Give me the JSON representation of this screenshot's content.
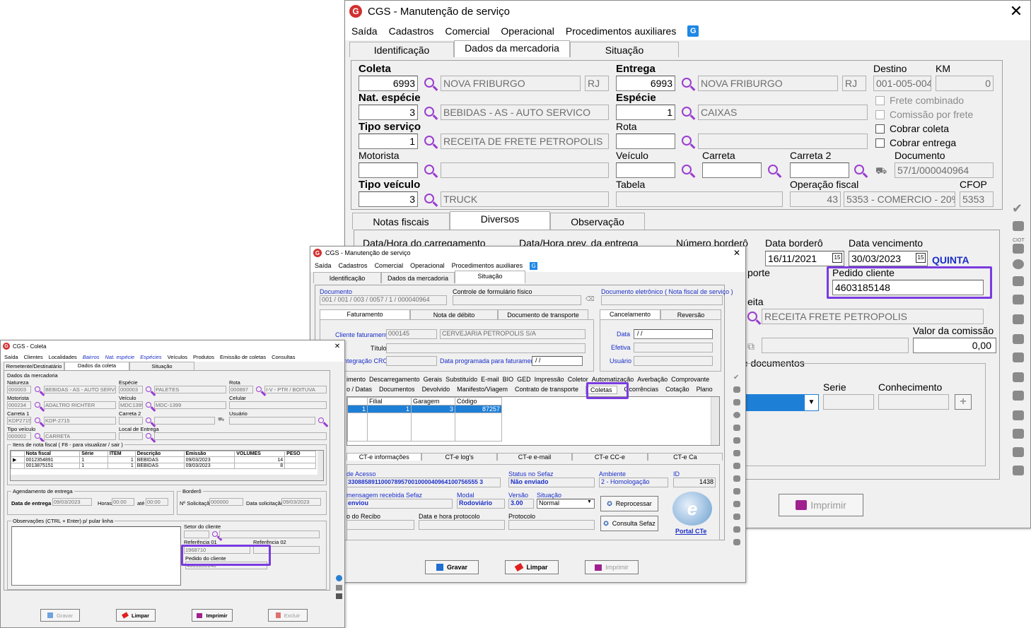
{
  "main": {
    "title": "CGS - Manutenção de serviço",
    "menu": [
      "Saída",
      "Cadastros",
      "Comercial",
      "Operacional",
      "Procedimentos auxiliares"
    ],
    "tabs": [
      "Identificação",
      "Dados da mercadoria",
      "Situação"
    ],
    "coleta_lbl": "Coleta",
    "coleta_code": "6993",
    "coleta_city": "NOVA FRIBURGO",
    "coleta_uf": "RJ",
    "entrega_lbl": "Entrega",
    "entrega_code": "6993",
    "entrega_city": "NOVA FRIBURGO",
    "entrega_uf": "RJ",
    "destino_lbl": "Destino",
    "destino": "001-005-004",
    "km_lbl": "KM",
    "km": "0",
    "natesp_lbl": "Nat. espécie",
    "natesp_code": "3",
    "natesp_desc": "BEBIDAS - AS - AUTO SERVICO",
    "especie_lbl": "Espécie",
    "especie_code": "1",
    "especie_desc": "CAIXAS",
    "frete_comb": "Frete combinado",
    "comissao": "Comissão por frete",
    "cobrar_coleta": "Cobrar coleta",
    "cobrar_entrega": "Cobrar entrega",
    "tiposerv_lbl": "Tipo serviço",
    "tiposerv_code": "1",
    "tiposerv_desc": "RECEITA DE FRETE PETROPOLIS",
    "rota_lbl": "Rota",
    "motorista_lbl": "Motorista",
    "veiculo_lbl": "Veículo",
    "carreta_lbl": "Carreta",
    "carreta2_lbl": "Carreta 2",
    "documento_lbl": "Documento",
    "documento": "57/1/000040964",
    "tipoveic_lbl": "Tipo veículo",
    "tipoveic_code": "3",
    "tipoveic_desc": "TRUCK",
    "tabela_lbl": "Tabela",
    "opfiscal_lbl": "Operação fiscal",
    "opfiscal_code": "43",
    "opfiscal_desc": "5353 - COMERCIO - 20%",
    "cfop_lbl": "CFOP",
    "cfop": "5353",
    "subtabs": [
      "Notas fiscais",
      "Diversos",
      "Observação"
    ],
    "dh_carreg": "Data/Hora do carregamento",
    "dh_prev": "Data/Hora prev. da entrega",
    "num_bordero": "Número borderô",
    "data_bordero_lbl": "Data borderô",
    "data_bordero": "16/11/2021",
    "data_venc_lbl": "Data vencimento",
    "data_venc": "30/03/2023",
    "dia": "QUINTA",
    "porte_frag": "porte",
    "pedido_lbl": "Pedido cliente",
    "pedido": "4603185148",
    "eita_frag": "eita",
    "receita": "RECEITA FRETE PETROPOLIS",
    "valor_com_lbl": "Valor da comissão",
    "valor_com": "0,00",
    "de_docs": "de documentos",
    "serie_lbl": "Serie",
    "conhec_lbl": "Conhecimento",
    "imprimir": "Imprimir",
    "side_label": "CIOT"
  },
  "mid": {
    "title": "CGS - Manutenção de serviço",
    "menu": [
      "Saída",
      "Cadastros",
      "Comercial",
      "Operacional",
      "Procedimentos auxiliares"
    ],
    "tabs": [
      "Identificação",
      "Dados da mercadoria",
      "Situação"
    ],
    "documento_lbl": "Documento",
    "documento": "001 / 001 / 003 / 0057 / 1 / 000040964",
    "controle_lbl": "Controle de formulário físico",
    "doc_eletr_lbl": "Documento eletrônico ( Nota fiscal de serviço )",
    "subtabs": [
      "Faturamento",
      "Nota de débito",
      "Documento de transporte"
    ],
    "subtabs2": [
      "Cancelamento",
      "Reversão"
    ],
    "cli_fat_lbl": "Cliente faturamento",
    "cli_fat_code": "000145",
    "cli_fat_name": "CERVEJARIA PETROPOLIS S/A",
    "titulo_lbl": "Título",
    "integ_lbl": "ntegração CRC",
    "data_prog_lbl": "Data programada para faturamento",
    "data_prog": "/  /",
    "data_lbl": "Data",
    "data_val": "/  /",
    "efetiva_lbl": "Efetiva",
    "usuario_lbl": "Usuário",
    "tabs3": [
      "imento",
      "Descarregamento",
      "Gerais",
      "Substituído",
      "E-mail",
      "BIO",
      "GED",
      "Impressão",
      "Coletor",
      "Automatização",
      "Averbação",
      "Comprovante"
    ],
    "tabs4": [
      "o / Datas",
      "Documentos",
      "Devolvido",
      "Manifesto/Viagem",
      "Contrato de transporte",
      "Coletas",
      "Ocorrências",
      "Cotação",
      "Plano"
    ],
    "grid_headers": [
      "Filial",
      "Garagem",
      "Código"
    ],
    "grid_row": [
      "1",
      "1",
      "3",
      "87257"
    ],
    "cte_tabs": [
      "CT-e informações",
      "CT-e log's",
      "CT-e e-mail",
      "CT-e CC-e",
      "CT-e Ca"
    ],
    "chave_lbl": "de Acesso",
    "chave": "330885891100078957001000040964100756555 3",
    "status_lbl": "Status no Sefaz",
    "status": "Não enviado",
    "ambiente_lbl": "Ambiente",
    "ambiente": "2 - Homologação",
    "id_lbl": "ID",
    "id": "1438",
    "msg_lbl": "mensagem recebida Sefaz",
    "msg": "enviou",
    "modal_lbl": "Modal",
    "modal": "Rodoviário",
    "versao_lbl": "Versão",
    "versao": "3.00",
    "situacao_lbl": "Situação",
    "situacao": "Normal",
    "reprocessar": "Reprocessar",
    "recibo_lbl": "o do Recibo",
    "dh_prot_lbl": "Data e hora protocolo",
    "protocolo_lbl": "Protocolo",
    "consulta": "Consulta Sefaz",
    "portal": "Portal CTe",
    "gravar": "Gravar",
    "limpar": "Limpar",
    "imprimir": "Imprimir"
  },
  "coleta": {
    "title": "CGS - Coleta",
    "menu": [
      "Saída",
      "Clientes",
      "Localidades",
      "Bairros",
      "Nat. espécie",
      "Espécies",
      "Veículos",
      "Produtos",
      "Emissão de coletas",
      "Consultas"
    ],
    "tabs": [
      "Remetente/Destinatário",
      "Dados da coleta",
      "Situação"
    ],
    "group": "Dados da mercadoria",
    "natureza_lbl": "Natureza",
    "natureza_code": "000003",
    "natureza_desc": "BEBIDAS - AS - AUTO SERVICO",
    "especie_lbl": "Espécie",
    "especie_code": "000003",
    "especie_desc": "PALETES",
    "rota_lbl": "Rota",
    "rota_code": "000897",
    "rota_desc": "I-V - PTR / BOITUVA",
    "motorista_lbl": "Motorista",
    "motorista_code": "000234",
    "motorista_name": "ADALTRO RICHTER",
    "veiculo_lbl": "Veículo",
    "veiculo_code": "MDC1399",
    "veiculo_desc": "MDC-1399",
    "celular_lbl": "Celular",
    "carreta1_lbl": "Carreta 1",
    "carreta1_code": "KDP2715",
    "carreta1_desc": "KDP-2715",
    "carreta2_lbl": "Carreta 2",
    "usuario_lbl": "Usuário",
    "tipoveic_lbl": "Tipo veículo",
    "tipoveic_code": "000002",
    "tipoveic_desc": "CARRETA",
    "local_lbl": "Local de Entrega",
    "itens_lbl": "Itens de nota fiscal ( F8 - para visualizar / sair )",
    "headers": [
      "Nota fiscal",
      "Série",
      "ITEM",
      "Descrição",
      "Emissão",
      "VOLUMES",
      "PESO"
    ],
    "rows": [
      [
        "0012354891",
        "1",
        "1",
        "BEBIDAS",
        "09/03/2023",
        "14",
        ""
      ],
      [
        "0013875151",
        "1",
        "1",
        "BEBIDAS",
        "09/03/2023",
        "8",
        ""
      ]
    ],
    "agend_lbl": "Agendamento de entrega",
    "dt_entrega_lbl": "Data de entrega",
    "dt_entrega": "09/03/2023",
    "horas_lbl": "Horas",
    "horas1": "00:00",
    "ate_lbl": "até",
    "horas2": "00:00",
    "bordero_lbl": "Borderô",
    "nsol_lbl": "Nº Solicitação",
    "nsol": "000000",
    "dtsol_lbl": "Data solicitação",
    "dtsol": "09/03/2023",
    "obs_lbl": "Observações (CTRL + Enter) p/ pular linha",
    "setor_lbl": "Setor do cliente",
    "ref1_lbl": "Referência 01",
    "ref1": "1968710",
    "ref2_lbl": "Referência 02",
    "pedido_lbl": "Pedido do cliente",
    "pedido": "4603185148",
    "gravar": "Gravar",
    "limpar": "Limpar",
    "imprimir": "Imprimir",
    "excluir": "Excluir"
  }
}
